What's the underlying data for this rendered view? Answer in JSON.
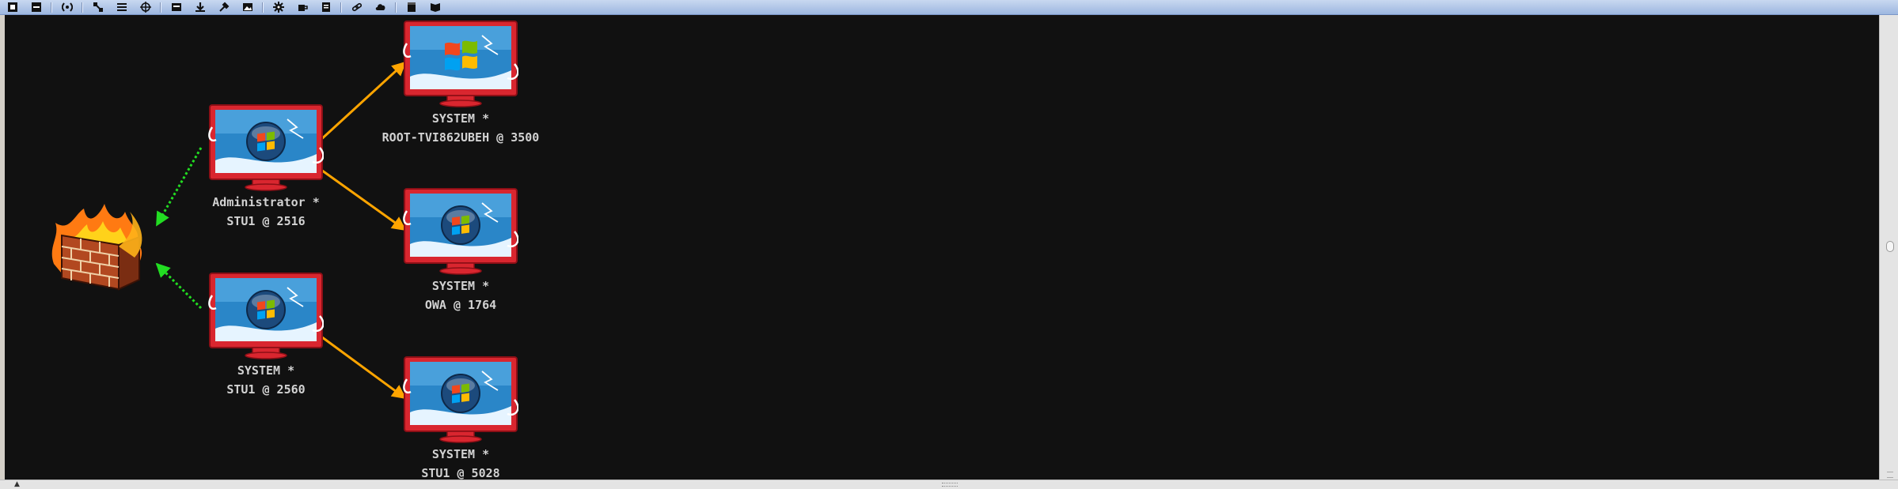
{
  "toolbar": {
    "items": [
      {
        "name": "new-connection-icon"
      },
      {
        "name": "disconnect-icon"
      },
      {
        "sep": true
      },
      {
        "name": "listeners-icon"
      },
      {
        "sep": true
      },
      {
        "name": "graph-view-icon"
      },
      {
        "name": "table-view-icon"
      },
      {
        "name": "target-icon"
      },
      {
        "sep": true
      },
      {
        "name": "credentials-icon"
      },
      {
        "name": "downloads-icon"
      },
      {
        "name": "keystrokes-icon"
      },
      {
        "name": "screenshots-icon"
      },
      {
        "sep": true
      },
      {
        "name": "generate-payload-icon"
      },
      {
        "name": "coffee-icon"
      },
      {
        "name": "script-icon"
      },
      {
        "sep": true
      },
      {
        "name": "link-icon"
      },
      {
        "name": "cloud-icon"
      },
      {
        "sep": true
      },
      {
        "name": "notes-icon"
      },
      {
        "name": "book-icon"
      }
    ]
  },
  "colors": {
    "canvas": "#111111",
    "pivot_arrow": "#ffa500",
    "firewall_arrow": "#22dd22",
    "label_text": "#d2d2d2",
    "monitor_frame": "#d9262f"
  },
  "firewall": {
    "icon": "firewall-icon"
  },
  "sessions": [
    {
      "user": "SYSTEM *",
      "host": "ROOT-TVI862UBEH @ 3500",
      "os_icon": "windows-xp-logo-icon"
    },
    {
      "user": "Administrator *",
      "host": "STU1 @ 2516",
      "os_icon": "windows-7-orb-icon"
    },
    {
      "user": "SYSTEM *",
      "host": "OWA @ 1764",
      "os_icon": "windows-7-orb-icon"
    },
    {
      "user": "SYSTEM *",
      "host": "STU1 @ 2560",
      "os_icon": "windows-7-orb-icon"
    },
    {
      "user": "SYSTEM *",
      "host": "STU1 @ 5028",
      "os_icon": "windows-7-orb-icon"
    }
  ],
  "links": [
    {
      "from": 1,
      "to": 0,
      "kind": "pivot"
    },
    {
      "from": 1,
      "to": 2,
      "kind": "pivot"
    },
    {
      "from": 3,
      "to": 4,
      "kind": "pivot"
    },
    {
      "from": 1,
      "to": "firewall",
      "kind": "egress"
    },
    {
      "from": 3,
      "to": "firewall",
      "kind": "egress"
    }
  ]
}
